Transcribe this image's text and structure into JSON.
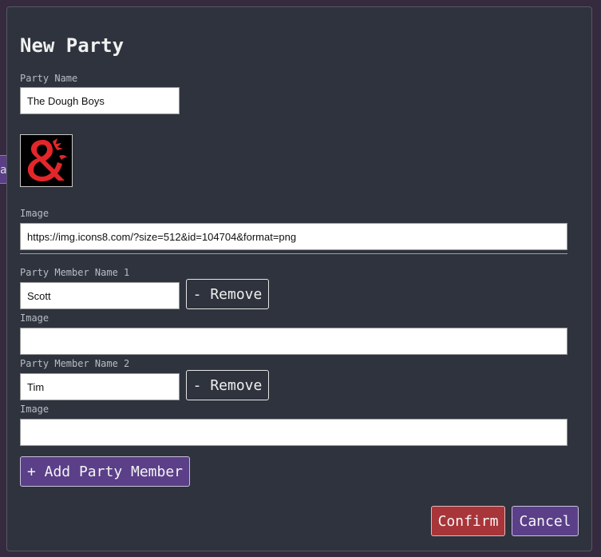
{
  "backdrop": {
    "tab_text": "a"
  },
  "modal": {
    "title": "New Party"
  },
  "party": {
    "name_label": "Party Name",
    "name_value": "The Dough Boys",
    "image_label": "Image",
    "image_value": "https://img.icons8.com/?size=512&id=104704&format=png",
    "avatar_icon": "dnd-ampersand-dragon-logo",
    "logo_color": "#e4262a"
  },
  "members": [
    {
      "name_label": "Party Member Name 1",
      "name_value": "Scott",
      "remove_label": "- Remove",
      "image_label": "Image",
      "image_value": ""
    },
    {
      "name_label": "Party Member Name 2",
      "name_value": "Tim",
      "remove_label": "- Remove",
      "image_label": "Image",
      "image_value": ""
    }
  ],
  "actions": {
    "add_member_label": "+ Add Party Member",
    "confirm_label": "Confirm",
    "cancel_label": "Cancel"
  },
  "colors": {
    "modal_bg": "#2e333d",
    "confirm": "#a83539",
    "accent_purple": "#5b3f88"
  }
}
